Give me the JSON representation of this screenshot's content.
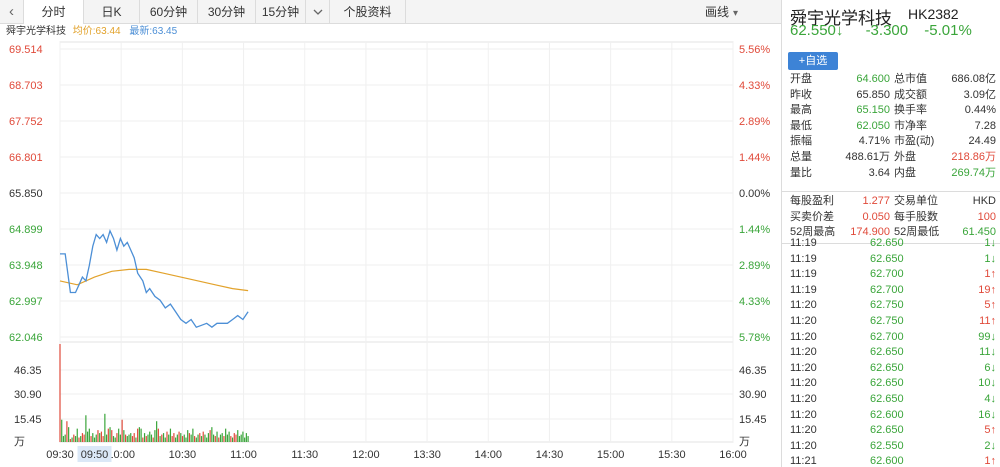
{
  "tabs": {
    "back": "‹",
    "items": [
      {
        "label": "分时"
      },
      {
        "label": "日K"
      },
      {
        "label": "60分钟"
      },
      {
        "label": "30分钟"
      },
      {
        "label": "15分钟"
      }
    ],
    "more_icon": "chevron-down-icon",
    "profile": "个股资料",
    "draw": "画线"
  },
  "chart_info": {
    "name": "舜宇光学科技",
    "avg_label": "均价:63.44",
    "latest_label": "最新:63.45"
  },
  "colors": {
    "up": "#e04a3a",
    "down": "#3aa53a",
    "price_line": "#4c8fd6",
    "avg_line": "#e2a22b",
    "accent": "#3d83d6"
  },
  "chart_data": {
    "type": "line",
    "price_ticks": [
      "69.514",
      "68.703",
      "67.752",
      "66.801",
      "65.850",
      "64.899",
      "63.948",
      "62.997",
      "62.046"
    ],
    "pct_ticks": [
      "5.56%",
      "4.33%",
      "2.89%",
      "1.44%",
      "0.00%",
      "1.44%",
      "2.89%",
      "4.33%",
      "5.78%"
    ],
    "vol_ticks": [
      "46.35",
      "30.90",
      "15.45",
      "万"
    ],
    "x_ticks": [
      "09:30",
      "10:00",
      "10:30",
      "11:00",
      "11:30",
      "12:00",
      "13:30",
      "14:00",
      "14:30",
      "15:00",
      "15:30",
      "16:00"
    ],
    "highlight_time": "09:50",
    "ylim": [
      62.046,
      69.514
    ],
    "vol_max": 61.8,
    "x_minutes_total": 390,
    "price_series": {
      "name": "最新",
      "t": [
        0,
        3,
        6,
        9,
        11,
        13,
        15,
        17,
        19,
        21,
        23,
        25,
        27,
        29,
        31,
        33,
        35,
        37,
        39,
        41,
        43,
        45,
        48,
        50,
        52,
        55,
        58,
        61,
        64,
        67,
        70,
        73,
        76,
        79,
        82,
        85,
        88,
        91,
        94,
        97,
        100,
        103,
        106,
        109
      ],
      "v": [
        64.2,
        64.2,
        63.2,
        63.2,
        63.4,
        63.6,
        63.5,
        63.9,
        64.4,
        64.7,
        64.6,
        64.7,
        64.5,
        64.8,
        64.6,
        64.3,
        64.6,
        64.4,
        64.5,
        64.3,
        64.1,
        63.7,
        63.5,
        63.2,
        63.3,
        63.1,
        63.0,
        62.8,
        62.9,
        62.7,
        62.5,
        62.4,
        62.5,
        62.3,
        62.35,
        62.4,
        62.3,
        62.4,
        62.4,
        62.4,
        62.5,
        62.6,
        62.5,
        62.7
      ]
    },
    "avg_series": {
      "name": "均价",
      "t": [
        0,
        10,
        20,
        30,
        40,
        50,
        60,
        70,
        80,
        90,
        100,
        109
      ],
      "v": [
        63.5,
        63.4,
        63.6,
        63.75,
        63.8,
        63.8,
        63.7,
        63.6,
        63.5,
        63.4,
        63.3,
        63.25
      ]
    },
    "volume": [
      6.6,
      1.5,
      0.4,
      0.5,
      1.4,
      1.0,
      0.2,
      0.3,
      0.5,
      0.4,
      0.9,
      0.3,
      0.4,
      0.6,
      0.5,
      1.8,
      0.7,
      0.9,
      0.4,
      0.6,
      0.3,
      0.5,
      0.8,
      0.6,
      0.7,
      0.4,
      1.9,
      0.5,
      0.9,
      1.0,
      0.8,
      0.4,
      0.3,
      0.6,
      0.9,
      0.5,
      1.5,
      0.8,
      0.5,
      0.4,
      0.5,
      0.6,
      0.4,
      0.6,
      0.3,
      0.9,
      1.0,
      0.9,
      0.3,
      0.6,
      0.4,
      0.5,
      0.7,
      0.5,
      0.3,
      0.8,
      1.4,
      0.9,
      0.4,
      0.5,
      0.6,
      0.3,
      0.7,
      0.5,
      0.9,
      0.4,
      0.6,
      0.3,
      0.5,
      0.7,
      0.6,
      0.4,
      0.5,
      0.3,
      0.8,
      0.6,
      0.5,
      0.9,
      0.4,
      0.3,
      0.5,
      0.6,
      0.4,
      0.7,
      0.5,
      0.3,
      0.6,
      0.8,
      1.0,
      0.5,
      0.4,
      0.7,
      0.3,
      0.5,
      0.6,
      0.4,
      0.9,
      0.5,
      0.7,
      0.4,
      0.3,
      0.6,
      0.5,
      0.8,
      0.4,
      0.5,
      0.7,
      0.3,
      0.6,
      0.4
    ],
    "volume_dir": "rgggrgrgrggrgrrgggrgggrgrrggrgrggrggrgrgggrrgrggrgrgggrggrgrggrggrrggrgrgggrggrggrgrgggrggrgrggrgggrgrrgg"
  },
  "quote": {
    "name": "舜宇光学科技",
    "code": "HK2382",
    "price": "62.550",
    "arrow": "↓",
    "change": "-3.300",
    "change_pct": "-5.01%",
    "add_watch": "+自选",
    "stats": [
      {
        "l1": "开盘",
        "v1": "64.600",
        "c1": "green",
        "l2": "总市值",
        "v2": "686.08亿",
        "c2": "dark"
      },
      {
        "l1": "昨收",
        "v1": "65.850",
        "c1": "dark",
        "l2": "成交额",
        "v2": "3.09亿",
        "c2": "dark"
      },
      {
        "l1": "最高",
        "v1": "65.150",
        "c1": "green",
        "l2": "换手率",
        "v2": "0.44%",
        "c2": "dark"
      },
      {
        "l1": "最低",
        "v1": "62.050",
        "c1": "green",
        "l2": "市净率",
        "v2": "7.28",
        "c2": "dark"
      },
      {
        "l1": "振幅",
        "v1": "4.71%",
        "c1": "dark",
        "l2": "市盈(动)",
        "v2": "24.49",
        "c2": "dark"
      },
      {
        "l1": "总量",
        "v1": "488.61万",
        "c1": "dark",
        "l2": "外盘",
        "v2": "218.86万",
        "c2": "red"
      },
      {
        "l1": "量比",
        "v1": "3.64",
        "c1": "dark",
        "l2": "内盘",
        "v2": "269.74万",
        "c2": "green"
      }
    ],
    "stats2": [
      {
        "l1": "每股盈利",
        "v1": "1.277",
        "c1": "red",
        "l2": "交易单位",
        "v2": "HKD",
        "c2": "dark"
      },
      {
        "l1": "买卖价差",
        "v1": "0.050",
        "c1": "red",
        "l2": "每手股数",
        "v2": "100",
        "c2": "red"
      },
      {
        "l1": "52周最高",
        "v1": "174.900",
        "c1": "red",
        "l2": "52周最低",
        "v2": "61.450",
        "c2": "green"
      }
    ],
    "ticks": [
      {
        "t": "11:19",
        "p": "62.650",
        "v": "1",
        "d": "↓",
        "c": "green"
      },
      {
        "t": "11:19",
        "p": "62.650",
        "v": "1",
        "d": "↓",
        "c": "green"
      },
      {
        "t": "11:19",
        "p": "62.700",
        "v": "1",
        "d": "↑",
        "c": "red"
      },
      {
        "t": "11:19",
        "p": "62.700",
        "v": "19",
        "d": "↑",
        "c": "red"
      },
      {
        "t": "11:20",
        "p": "62.750",
        "v": "5",
        "d": "↑",
        "c": "red"
      },
      {
        "t": "11:20",
        "p": "62.750",
        "v": "11",
        "d": "↑",
        "c": "red"
      },
      {
        "t": "11:20",
        "p": "62.700",
        "v": "99",
        "d": "↓",
        "c": "green"
      },
      {
        "t": "11:20",
        "p": "62.650",
        "v": "11",
        "d": "↓",
        "c": "green"
      },
      {
        "t": "11:20",
        "p": "62.650",
        "v": "6",
        "d": "↓",
        "c": "green"
      },
      {
        "t": "11:20",
        "p": "62.650",
        "v": "10",
        "d": "↓",
        "c": "green"
      },
      {
        "t": "11:20",
        "p": "62.650",
        "v": "4",
        "d": "↓",
        "c": "green"
      },
      {
        "t": "11:20",
        "p": "62.600",
        "v": "16",
        "d": "↓",
        "c": "green"
      },
      {
        "t": "11:20",
        "p": "62.650",
        "v": "5",
        "d": "↑",
        "c": "red"
      },
      {
        "t": "11:20",
        "p": "62.550",
        "v": "2",
        "d": "↓",
        "c": "green"
      },
      {
        "t": "11:21",
        "p": "62.600",
        "v": "1",
        "d": "↑",
        "c": "red"
      }
    ]
  }
}
